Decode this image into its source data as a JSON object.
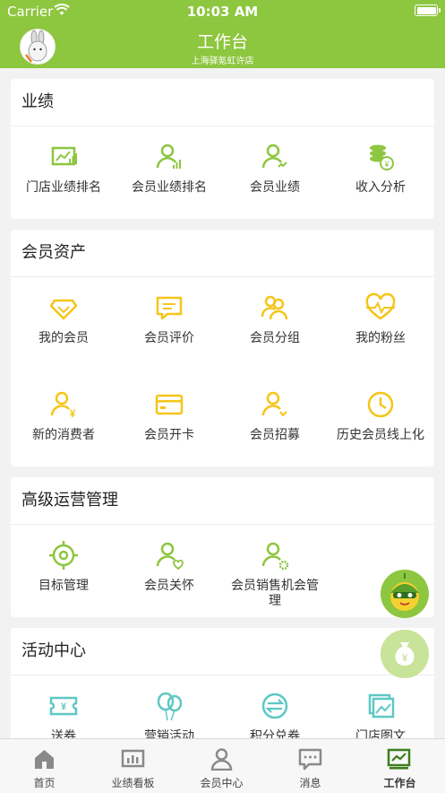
{
  "status_bar": {
    "carrier": "Carrier",
    "time": "10:03 AM"
  },
  "header": {
    "title": "工作台",
    "subtitle": "上海驿氪虹许店"
  },
  "sections": [
    {
      "title": "业绩",
      "items": [
        {
          "label": "门店业绩排名",
          "icon": "store-chart-icon"
        },
        {
          "label": "会员业绩排名",
          "icon": "member-rank-icon"
        },
        {
          "label": "会员业绩",
          "icon": "member-performance-icon"
        },
        {
          "label": "收入分析",
          "icon": "coin-stack-icon"
        }
      ]
    },
    {
      "title": "会员资产",
      "items": [
        {
          "label": "我的会员",
          "icon": "diamond-icon"
        },
        {
          "label": "会员评价",
          "icon": "comment-icon"
        },
        {
          "label": "会员分组",
          "icon": "group-icon"
        },
        {
          "label": "我的粉丝",
          "icon": "heart-pulse-icon"
        },
        {
          "label": "新的消费者",
          "icon": "new-consumer-icon"
        },
        {
          "label": "会员开卡",
          "icon": "card-icon"
        },
        {
          "label": "会员招募",
          "icon": "recruit-icon"
        },
        {
          "label": "历史会员线上化",
          "icon": "clock-icon"
        }
      ]
    },
    {
      "title": "高级运营管理",
      "items": [
        {
          "label": "目标管理",
          "icon": "target-icon"
        },
        {
          "label": "会员关怀",
          "icon": "member-care-icon"
        },
        {
          "label": "会员销售机会管理",
          "icon": "member-settings-icon"
        }
      ]
    },
    {
      "title": "活动中心",
      "items": [
        {
          "label": "送券",
          "icon": "coupon-icon"
        },
        {
          "label": "营销活动",
          "icon": "balloon-icon"
        },
        {
          "label": "积分兑券",
          "icon": "exchange-icon"
        },
        {
          "label": "门店图文",
          "icon": "image-icon"
        }
      ]
    }
  ],
  "tabs": [
    {
      "label": "首页",
      "icon": "home-icon"
    },
    {
      "label": "业绩看板",
      "icon": "dashboard-icon"
    },
    {
      "label": "会员中心",
      "icon": "user-icon"
    },
    {
      "label": "消息",
      "icon": "message-icon"
    },
    {
      "label": "工作台",
      "icon": "workbench-icon",
      "active": true
    }
  ],
  "float_buttons": [
    {
      "icon": "mascot-icon"
    },
    {
      "icon": "money-bag-icon"
    }
  ],
  "colors": {
    "brand_green": "#8dc63f",
    "icon_green": "#8dc63f",
    "icon_yellow": "#f5c518",
    "icon_teal": "#5ec8c4",
    "tab_inactive": "#8a8a8a"
  }
}
